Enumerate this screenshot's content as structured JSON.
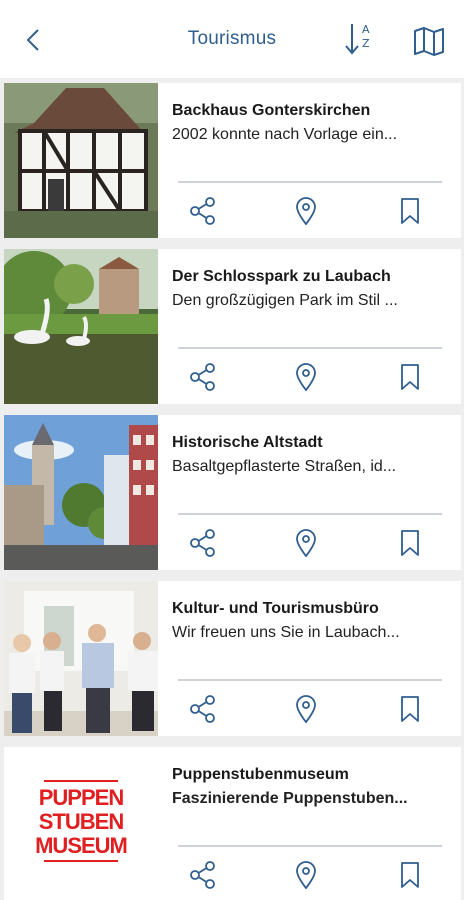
{
  "header": {
    "title": "Tourismus",
    "sort_glyph": "A\nZ",
    "icons": [
      "back-chevron-icon",
      "sort-az-icon",
      "map-icon"
    ]
  },
  "accent_color": "#2f5e8f",
  "items": [
    {
      "title": "Backhaus Gonterskirchen",
      "description": "2002 konnte nach Vorlage ein..."
    },
    {
      "title": "Der Schlosspark zu Laubach",
      "description": "Den großzügigen Park im Stil ..."
    },
    {
      "title": "Historische Altstadt",
      "description": "Basaltgepflasterte Straßen, id..."
    },
    {
      "title": "Kultur- und Tourismusbüro",
      "description": "Wir freuen uns Sie in Laubach..."
    },
    {
      "title": "Puppenstubenmuseum",
      "description": "Faszinierende Puppenstuben...",
      "logo_text": "PUPPEN STUBEN MUSEUM"
    }
  ],
  "card_actions": [
    "share-icon",
    "location-pin-icon",
    "bookmark-icon"
  ]
}
